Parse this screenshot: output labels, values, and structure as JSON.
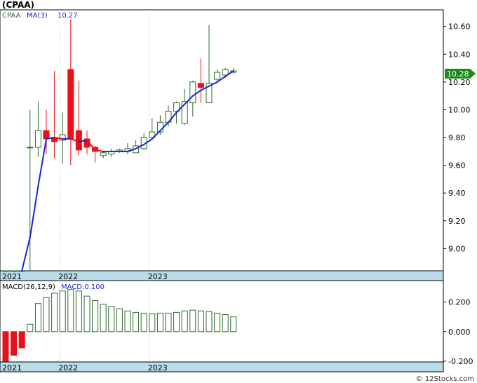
{
  "title": "(CPAA)",
  "watermark": "© 12Stocks.com",
  "price_legend": {
    "ticker": "CPAA",
    "ma_label": "MA(3)",
    "ma_value": "10.27"
  },
  "price_badge": "10.28",
  "macd_legend": {
    "label": "MACD(26,12,9)",
    "value_label": "MACD:0.100"
  },
  "x_labels": [
    "2021",
    "2022",
    "2023"
  ],
  "price_y_ticks": [
    "10.60",
    "10.40",
    "10.20",
    "10.00",
    "9.80",
    "9.60",
    "9.40",
    "9.20",
    "9.00"
  ],
  "macd_y_ticks": [
    "0.200",
    "0.000",
    "-0.200"
  ],
  "colors": {
    "up": "#2e6b2e",
    "down": "#e8101a",
    "ma_up": "#1428d0",
    "ma_down": "#e8101a",
    "axis_band": "#b8dce8",
    "badge": "#1a8a1a"
  },
  "chart_data": [
    {
      "type": "candlestick",
      "period": "monthly",
      "ylim": [
        8.84,
        10.72
      ],
      "x_label_index": {
        "2021": 0,
        "2022": 7,
        "2023": 18
      },
      "candles": [
        {
          "open": 8.84,
          "high": 8.84,
          "low": 8.84,
          "close": 8.84
        },
        {
          "open": 8.84,
          "high": 8.84,
          "low": 8.84,
          "close": 8.84
        },
        {
          "open": 8.84,
          "high": 8.84,
          "low": 8.84,
          "close": 8.84
        },
        {
          "open": 9.73,
          "high": 10.0,
          "low": 8.84,
          "close": 9.73
        },
        {
          "open": 9.73,
          "high": 10.06,
          "low": 9.66,
          "close": 9.85
        },
        {
          "open": 9.85,
          "high": 10.0,
          "low": 9.68,
          "close": 9.79
        },
        {
          "open": 9.8,
          "high": 10.28,
          "low": 9.65,
          "close": 9.77
        },
        {
          "open": 9.78,
          "high": 9.98,
          "low": 9.61,
          "close": 9.82
        },
        {
          "open": 10.29,
          "high": 10.65,
          "low": 9.6,
          "close": 9.79
        },
        {
          "open": 9.85,
          "high": 10.21,
          "low": 9.67,
          "close": 9.71
        },
        {
          "open": 9.79,
          "high": 9.85,
          "low": 9.68,
          "close": 9.73
        },
        {
          "open": 9.73,
          "high": 9.74,
          "low": 9.62,
          "close": 9.7
        },
        {
          "open": 9.67,
          "high": 9.7,
          "low": 9.65,
          "close": 9.69
        },
        {
          "open": 9.68,
          "high": 9.72,
          "low": 9.66,
          "close": 9.7
        },
        {
          "open": 9.7,
          "high": 9.72,
          "low": 9.69,
          "close": 9.71
        },
        {
          "open": 9.7,
          "high": 9.76,
          "low": 9.68,
          "close": 9.72
        },
        {
          "open": 9.69,
          "high": 9.78,
          "low": 9.69,
          "close": 9.74
        },
        {
          "open": 9.72,
          "high": 9.83,
          "low": 9.71,
          "close": 9.8
        },
        {
          "open": 9.8,
          "high": 9.94,
          "low": 9.78,
          "close": 9.84
        },
        {
          "open": 9.84,
          "high": 9.96,
          "low": 9.82,
          "close": 9.91
        },
        {
          "open": 9.91,
          "high": 10.03,
          "low": 9.88,
          "close": 9.99
        },
        {
          "open": 9.99,
          "high": 10.06,
          "low": 9.9,
          "close": 10.05
        },
        {
          "open": 9.9,
          "high": 10.15,
          "low": 9.89,
          "close": 10.06
        },
        {
          "open": 10.05,
          "high": 10.21,
          "low": 9.95,
          "close": 10.2
        },
        {
          "open": 10.19,
          "high": 10.37,
          "low": 10.05,
          "close": 10.16
        },
        {
          "open": 10.05,
          "high": 10.61,
          "low": 10.05,
          "close": 10.19
        },
        {
          "open": 10.22,
          "high": 10.29,
          "low": 10.19,
          "close": 10.27
        },
        {
          "open": 10.25,
          "high": 10.3,
          "low": 10.23,
          "close": 10.29
        },
        {
          "open": 10.27,
          "high": 10.3,
          "low": 10.26,
          "close": 10.28
        }
      ],
      "ma3": [
        null,
        null,
        8.84,
        9.08,
        9.45,
        9.79,
        9.8,
        9.79,
        9.79,
        9.77,
        9.78,
        9.71,
        9.7,
        9.7,
        9.7,
        9.7,
        9.72,
        9.75,
        9.79,
        9.85,
        9.91,
        9.98,
        10.04,
        10.1,
        10.14,
        10.17,
        10.2,
        10.24,
        10.28
      ]
    },
    {
      "type": "bar",
      "name": "MACD(26,12,9)",
      "ylim": [
        -0.205,
        0.345
      ],
      "values": [
        -0.2,
        -0.16,
        -0.11,
        0.05,
        0.19,
        0.23,
        0.26,
        0.275,
        0.285,
        0.275,
        0.24,
        0.21,
        0.185,
        0.17,
        0.155,
        0.14,
        0.13,
        0.125,
        0.12,
        0.125,
        0.125,
        0.13,
        0.14,
        0.145,
        0.14,
        0.135,
        0.125,
        0.115,
        0.1
      ]
    }
  ]
}
